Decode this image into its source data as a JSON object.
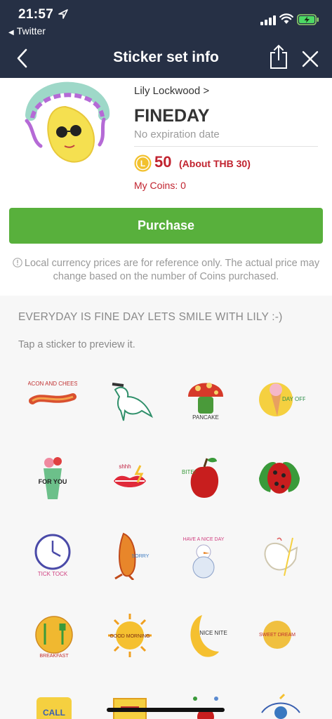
{
  "status_bar": {
    "time": "21:57",
    "back_app": "Twitter"
  },
  "nav": {
    "title": "Sticker set info"
  },
  "sticker_set": {
    "author": "Lily Lockwood >",
    "title": "FINEDAY",
    "expiry": "No expiration date",
    "price_coins": "50",
    "price_local": "(About THB 30)",
    "my_coins": "My Coins: 0"
  },
  "purchase_label": "Purchase",
  "notice": "Local currency prices are for reference only. The actual price may change based on the number of Coins purchased.",
  "description": "EVERYDAY IS FINE DAY LETS SMILE WITH LILY :-)",
  "tap_hint": "Tap a sticker to preview it.",
  "colors": {
    "nav_bg": "#263045",
    "purchase_green": "#58b03c",
    "price_red": "#c1232f"
  },
  "stickers": {
    "s1": {
      "text": "BACON AND CHEESE"
    },
    "s3": {
      "text": "PANCAKE"
    },
    "s4": {
      "text": "DAY OFF"
    },
    "s5": {
      "text": "FOR YOU"
    },
    "s6": {
      "text": "shhh"
    },
    "s7": {
      "text": "BITE!"
    },
    "s9": {
      "text": "TICK TOCK"
    },
    "s10": {
      "text": "SORRY"
    },
    "s11": {
      "text": "HAVE A NICE DAY"
    },
    "s13": {
      "text": "BREAKFAST"
    },
    "s14": {
      "text": "GOOD MORNING"
    },
    "s15": {
      "text": "NICE NITE"
    },
    "s16": {
      "text": "SWEET DREAM"
    },
    "s17": {
      "text": "CALL"
    }
  }
}
